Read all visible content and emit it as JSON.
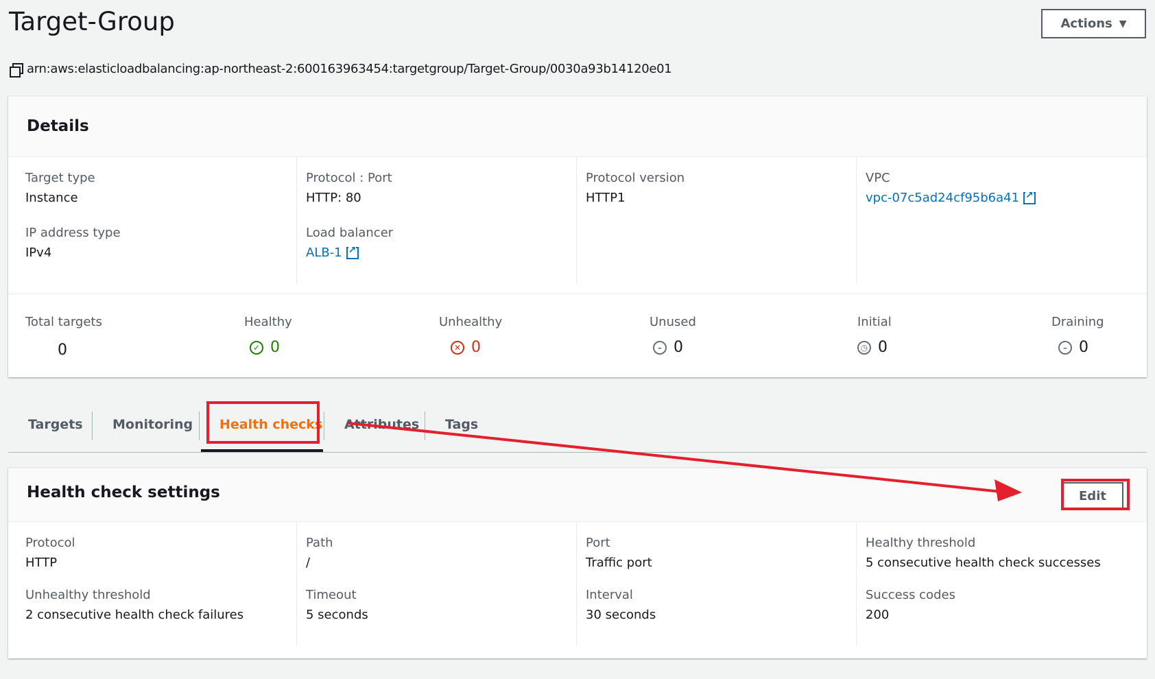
{
  "header": {
    "title": "Target-Group",
    "actions_label": "Actions",
    "arn": "arn:aws:elasticloadbalancing:ap-northeast-2:600163963454:targetgroup/Target-Group/0030a93b14120e01"
  },
  "details": {
    "title": "Details",
    "target_type": {
      "label": "Target type",
      "value": "Instance"
    },
    "ip_address_type": {
      "label": "IP address type",
      "value": "IPv4"
    },
    "protocol_port": {
      "label": "Protocol : Port",
      "value": "HTTP: 80"
    },
    "load_balancer": {
      "label": "Load balancer",
      "value": "ALB-1"
    },
    "protocol_version": {
      "label": "Protocol version",
      "value": "HTTP1"
    },
    "vpc": {
      "label": "VPC",
      "value": "vpc-07c5ad24cf95b6a41"
    }
  },
  "counts": {
    "total": {
      "label": "Total targets",
      "value": "0"
    },
    "healthy": {
      "label": "Healthy",
      "value": "0"
    },
    "unhealthy": {
      "label": "Unhealthy",
      "value": "0"
    },
    "unused": {
      "label": "Unused",
      "value": "0"
    },
    "initial": {
      "label": "Initial",
      "value": "0"
    },
    "draining": {
      "label": "Draining",
      "value": "0"
    }
  },
  "tabs": [
    {
      "label": "Targets"
    },
    {
      "label": "Monitoring"
    },
    {
      "label": "Health checks",
      "active": true
    },
    {
      "label": "Attributes"
    },
    {
      "label": "Tags"
    }
  ],
  "health_check": {
    "title": "Health check settings",
    "edit_label": "Edit",
    "protocol": {
      "label": "Protocol",
      "value": "HTTP"
    },
    "unhealthy_threshold": {
      "label": "Unhealthy threshold",
      "value": "2 consecutive health check failures"
    },
    "path": {
      "label": "Path",
      "value": "/"
    },
    "timeout": {
      "label": "Timeout",
      "value": "5 seconds"
    },
    "port": {
      "label": "Port",
      "value": "Traffic port"
    },
    "interval": {
      "label": "Interval",
      "value": "30 seconds"
    },
    "healthy_threshold": {
      "label": "Healthy threshold",
      "value": "5 consecutive health check successes"
    },
    "success_codes": {
      "label": "Success codes",
      "value": "200"
    }
  },
  "colors": {
    "link": "#0073bb",
    "active_tab": "#ec7211",
    "healthy": "#1d8102",
    "unhealthy": "#d13212",
    "annotation": "#e4202c"
  }
}
